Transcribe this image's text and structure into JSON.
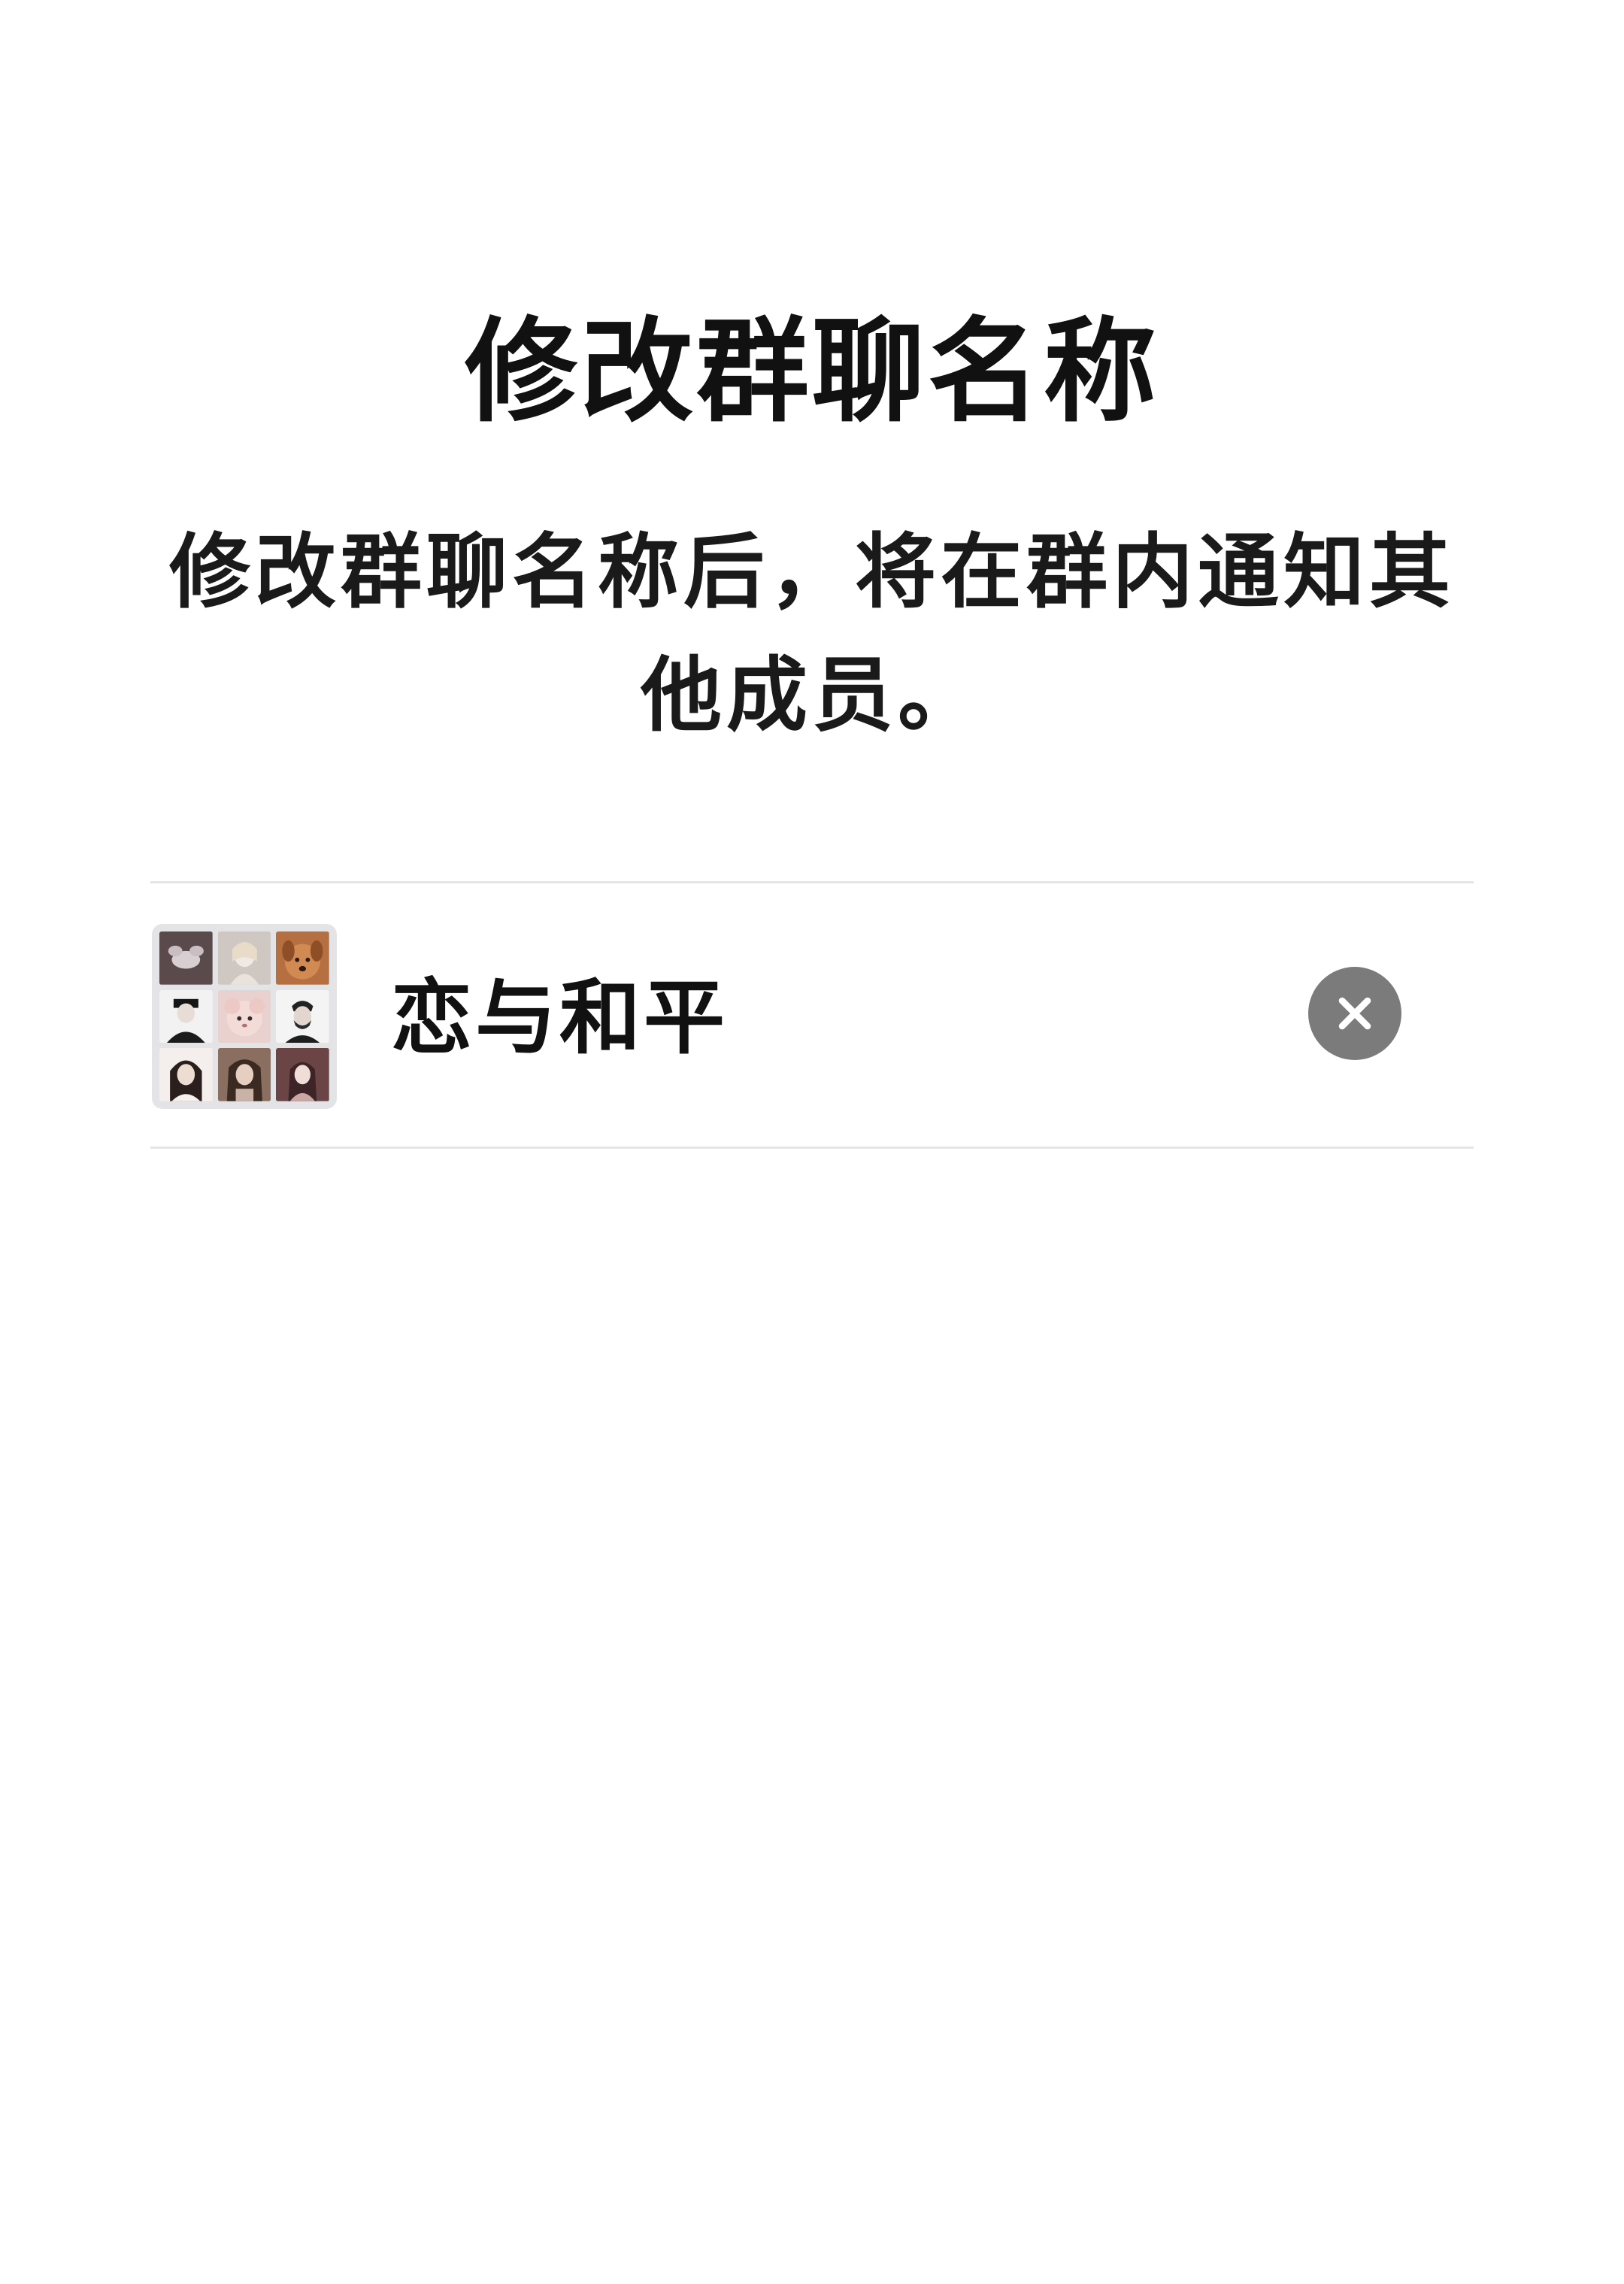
{
  "dialog": {
    "title": "修改群聊名称",
    "description": "修改群聊名称后，将在群内通知其他成员。"
  },
  "name_field": {
    "value": "恋与和平",
    "avatar_icon": "group-avatar-grid",
    "clear_icon": "close-icon"
  },
  "colors": {
    "background": "#ffffff",
    "text": "#111111",
    "divider": "#e5e5e5",
    "clear_button": "#7b7b7b"
  }
}
